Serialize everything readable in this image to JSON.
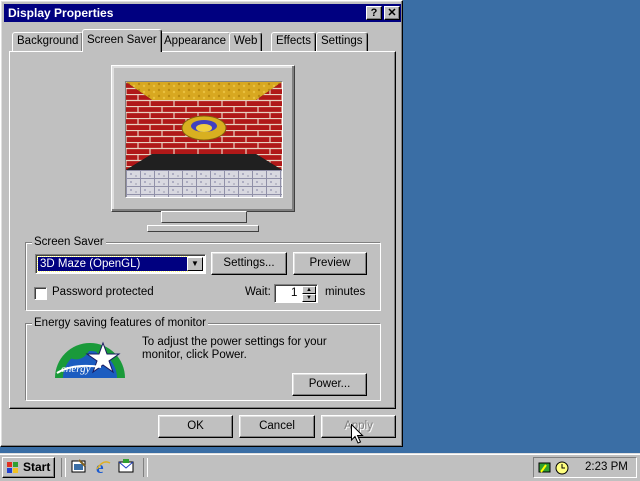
{
  "window": {
    "title": "Display Properties",
    "help_button": "?",
    "close_button": "✕"
  },
  "tabs": [
    {
      "label": "Background"
    },
    {
      "label": "Screen Saver"
    },
    {
      "label": "Appearance"
    },
    {
      "label": "Web"
    },
    {
      "label": "Effects"
    },
    {
      "label": "Settings"
    }
  ],
  "active_tab": "Screen Saver",
  "screen_saver": {
    "group_label": "Screen Saver",
    "selected": "3D Maze (OpenGL)",
    "settings_button": "Settings...",
    "preview_button": "Preview",
    "password_label": "Password protected",
    "password_checked": false,
    "wait_label": "Wait:",
    "wait_value": "1",
    "wait_units": "minutes"
  },
  "energy": {
    "group_label": "Energy saving features of monitor",
    "description": "To adjust the power settings for your monitor, click Power.",
    "power_button": "Power...",
    "logo_text": "energy"
  },
  "dialog_buttons": {
    "ok": "OK",
    "cancel": "Cancel",
    "apply": "Apply"
  },
  "taskbar": {
    "start_label": "Start",
    "clock": "2:23 PM"
  },
  "colors": {
    "desktop": "#3a6ea5",
    "titlebar": "#000080",
    "face": "#c0c0c0"
  }
}
